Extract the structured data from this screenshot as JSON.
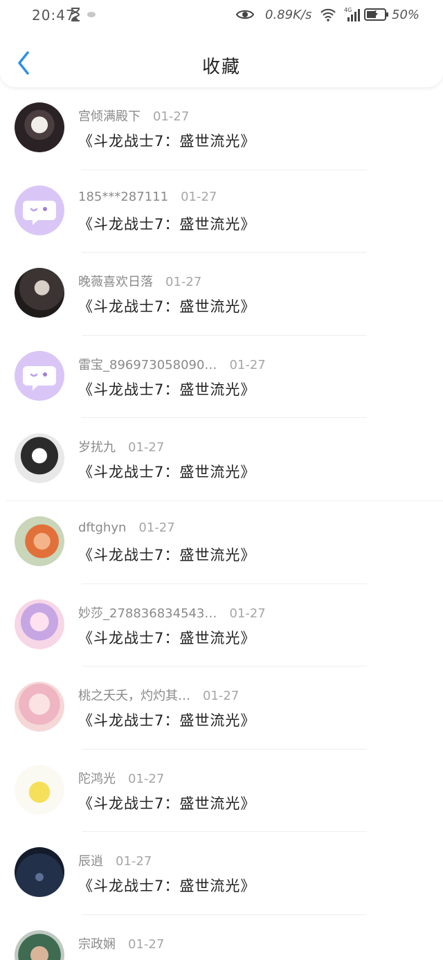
{
  "status_bar": {
    "time": "20:47",
    "net_speed": "0.89K/s",
    "network_type": "4G",
    "battery": "50%"
  },
  "header": {
    "title": "收藏"
  },
  "favorites": [
    {
      "user": "宫倾满殿下",
      "date": "01-27",
      "book": "《斗龙战士7：盛世流光》"
    },
    {
      "user": "185***287111",
      "date": "01-27",
      "book": "《斗龙战士7：盛世流光》"
    },
    {
      "user": "晚薇喜欢日落",
      "date": "01-27",
      "book": "《斗龙战士7：盛世流光》"
    },
    {
      "user": "雷宝_896973058090…",
      "date": "01-27",
      "book": "《斗龙战士7：盛世流光》"
    },
    {
      "user": "岁扰九",
      "date": "01-27",
      "book": "《斗龙战士7：盛世流光》"
    },
    {
      "user": "dftghyn",
      "date": "01-27",
      "book": "《斗龙战士7：盛世流光》"
    },
    {
      "user": "妙莎_278836834543…",
      "date": "01-27",
      "book": "《斗龙战士7：盛世流光》"
    },
    {
      "user": "桃之夭夭，灼灼其…",
      "date": "01-27",
      "book": "《斗龙战士7：盛世流光》"
    },
    {
      "user": "陀鸿光",
      "date": "01-27",
      "book": "《斗龙战士7：盛世流光》"
    },
    {
      "user": "辰逍",
      "date": "01-27",
      "book": "《斗龙战士7：盛世流光》"
    },
    {
      "user": "宗政娴",
      "date": "01-27",
      "book": ""
    }
  ],
  "colors": {
    "accent": "#2f8fe6",
    "default_avatar": "#d9c6f6"
  },
  "icons": {
    "back": "chevron-left-icon",
    "default_avatar": "chat-bubble-icon"
  }
}
